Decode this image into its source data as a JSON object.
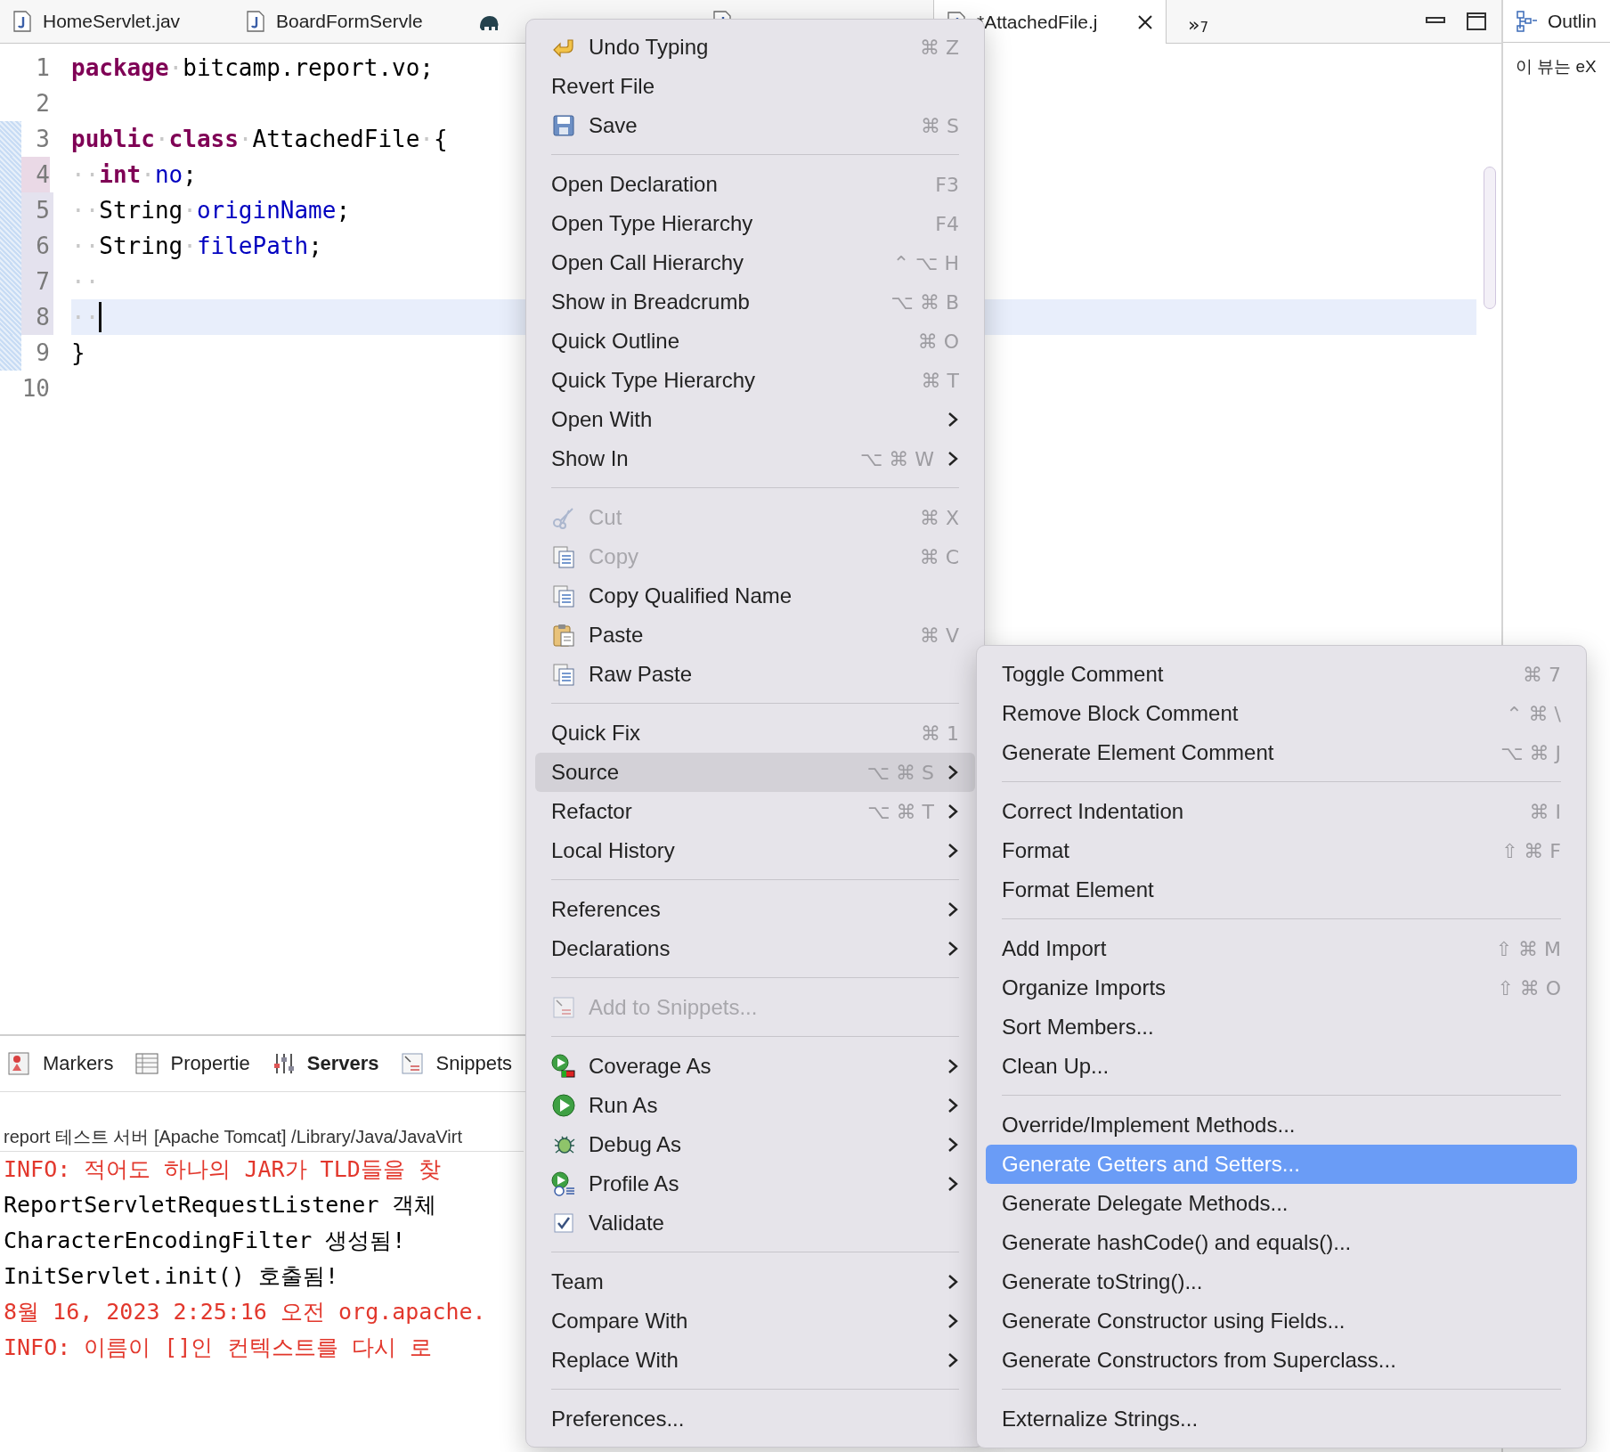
{
  "editor_tabs": [
    {
      "label": "HomeServlet.jav",
      "selected": false
    },
    {
      "label": "BoardFormServle",
      "selected": false
    },
    {
      "selected": false
    },
    {
      "selected": false
    },
    {
      "label": "*AttachedFile.j",
      "selected": true
    }
  ],
  "tab_overflow": {
    "symbol": "»",
    "count": "7"
  },
  "code_lines": [
    {
      "number": "1",
      "tokens": [
        {
          "text": "package",
          "kind": "keyword"
        },
        {
          "text": "·",
          "kind": "space"
        },
        {
          "text": "bitcamp.report.vo;",
          "kind": "plain"
        }
      ],
      "modified": false,
      "added": false,
      "range_indicator": false,
      "current": false
    },
    {
      "number": "2",
      "modified": false,
      "added": false,
      "range_indicator": false,
      "current": false
    },
    {
      "number": "3",
      "tokens": [
        {
          "text": "public",
          "kind": "keyword"
        },
        {
          "text": "·",
          "kind": "space"
        },
        {
          "text": "class",
          "kind": "keyword"
        },
        {
          "text": "·",
          "kind": "space"
        },
        {
          "text": "AttachedFile",
          "kind": "plain"
        },
        {
          "text": "·",
          "kind": "space"
        },
        {
          "text": "{",
          "kind": "plain"
        }
      ],
      "modified": false,
      "added": false,
      "range_indicator": true,
      "current": false
    },
    {
      "number": "4",
      "tokens": [
        {
          "text": "··",
          "kind": "space"
        },
        {
          "text": "int",
          "kind": "keyword"
        },
        {
          "text": "·",
          "kind": "space"
        },
        {
          "text": "no",
          "kind": "field"
        },
        {
          "text": ";",
          "kind": "plain"
        }
      ],
      "modified": true,
      "added": false,
      "range_indicator": true,
      "current": false
    },
    {
      "number": "5",
      "tokens": [
        {
          "text": "··",
          "kind": "space"
        },
        {
          "text": "String",
          "kind": "plain"
        },
        {
          "text": "·",
          "kind": "space"
        },
        {
          "text": "originName",
          "kind": "field"
        },
        {
          "text": ";",
          "kind": "plain"
        }
      ],
      "modified": false,
      "added": true,
      "range_indicator": true,
      "current": false
    },
    {
      "number": "6",
      "tokens": [
        {
          "text": "··",
          "kind": "space"
        },
        {
          "text": "String",
          "kind": "plain"
        },
        {
          "text": "·",
          "kind": "space"
        },
        {
          "text": "filePath",
          "kind": "field"
        },
        {
          "text": ";",
          "kind": "plain"
        }
      ],
      "modified": false,
      "added": true,
      "range_indicator": true,
      "current": false
    },
    {
      "number": "7",
      "tokens": [
        {
          "text": "··",
          "kind": "space"
        }
      ],
      "modified": false,
      "added": true,
      "range_indicator": true,
      "current": false
    },
    {
      "number": "8",
      "tokens": [
        {
          "text": "··",
          "kind": "space"
        }
      ],
      "modified": false,
      "added": true,
      "range_indicator": true,
      "current": true
    },
    {
      "number": "9",
      "tokens": [
        {
          "text": "}",
          "kind": "plain"
        }
      ],
      "modified": false,
      "added": false,
      "range_indicator": true,
      "current": false
    },
    {
      "number": "10",
      "modified": false,
      "added": false,
      "range_indicator": false,
      "current": false
    }
  ],
  "view_tabs": [
    {
      "label": "Markers",
      "selected": false
    },
    {
      "label": "Propertie",
      "selected": false
    },
    {
      "label": "Servers",
      "selected": true
    },
    {
      "label": "Snippets",
      "selected": false
    }
  ],
  "console": {
    "title": "report 테스트 서버 [Apache Tomcat] /Library/Java/JavaVirt",
    "lines": [
      {
        "text": "INFO: 적어도 하나의 JAR가 TLD들을 찾",
        "error": true
      },
      {
        "text": "ReportServletRequestListener 객체",
        "error": false
      },
      {
        "text": "CharacterEncodingFilter 생성됨!",
        "error": false
      },
      {
        "text": "InitServlet.init() 호출됨!",
        "error": false
      },
      {
        "text": "8월 16, 2023 2:25:16 오전 org.apache.",
        "error": true
      },
      {
        "text": "INFO: 이름이 []인 컨텍스트를 다시 로",
        "error": true
      }
    ]
  },
  "outline": {
    "tab": "Outlin",
    "message": "이 뷰는 eX"
  },
  "context_menu": {
    "groups": [
      {
        "items": [
          {
            "label": "Undo Typing",
            "shortcut": "⌘ Z",
            "submenu": false,
            "disabled": false,
            "selected": false
          },
          {
            "label": "Revert File",
            "submenu": false,
            "disabled": false,
            "selected": false
          },
          {
            "label": "Save",
            "shortcut": "⌘ S",
            "submenu": false,
            "disabled": false,
            "selected": false
          }
        ]
      },
      {
        "items": [
          {
            "label": "Open Declaration",
            "shortcut": "F3",
            "submenu": false,
            "disabled": false,
            "selected": false
          },
          {
            "label": "Open Type Hierarchy",
            "shortcut": "F4",
            "submenu": false,
            "disabled": false,
            "selected": false
          },
          {
            "label": "Open Call Hierarchy",
            "shortcut": "⌃ ⌥ H",
            "submenu": false,
            "disabled": false,
            "selected": false
          },
          {
            "label": "Show in Breadcrumb",
            "shortcut": "⌥ ⌘ B",
            "submenu": false,
            "disabled": false,
            "selected": false
          },
          {
            "label": "Quick Outline",
            "shortcut": "⌘ O",
            "submenu": false,
            "disabled": false,
            "selected": false
          },
          {
            "label": "Quick Type Hierarchy",
            "shortcut": "⌘ T",
            "submenu": false,
            "disabled": false,
            "selected": false
          },
          {
            "label": "Open With",
            "submenu": true,
            "disabled": false,
            "selected": false
          },
          {
            "label": "Show In",
            "shortcut": "⌥ ⌘ W",
            "submenu": true,
            "disabled": false,
            "selected": false
          }
        ]
      },
      {
        "items": [
          {
            "label": "Cut",
            "shortcut": "⌘ X",
            "submenu": false,
            "disabled": true,
            "selected": false
          },
          {
            "label": "Copy",
            "shortcut": "⌘ C",
            "submenu": false,
            "disabled": true,
            "selected": false
          },
          {
            "label": "Copy Qualified Name",
            "submenu": false,
            "disabled": false,
            "selected": false
          },
          {
            "label": "Paste",
            "shortcut": "⌘ V",
            "submenu": false,
            "disabled": false,
            "selected": false
          },
          {
            "label": "Raw Paste",
            "submenu": false,
            "disabled": false,
            "selected": false
          }
        ]
      },
      {
        "items": [
          {
            "label": "Quick Fix",
            "shortcut": "⌘ 1",
            "submenu": false,
            "disabled": false,
            "selected": false
          },
          {
            "label": "Source",
            "shortcut": "⌥ ⌘ S",
            "submenu": true,
            "disabled": false,
            "selected": true
          },
          {
            "label": "Refactor",
            "shortcut": "⌥ ⌘ T",
            "submenu": true,
            "disabled": false,
            "selected": false
          },
          {
            "label": "Local History",
            "submenu": true,
            "disabled": false,
            "selected": false
          }
        ]
      },
      {
        "items": [
          {
            "label": "References",
            "submenu": true,
            "disabled": false,
            "selected": false
          },
          {
            "label": "Declarations",
            "submenu": true,
            "disabled": false,
            "selected": false
          }
        ]
      },
      {
        "items": [
          {
            "label": "Add to Snippets...",
            "submenu": false,
            "disabled": true,
            "selected": false
          }
        ]
      },
      {
        "items": [
          {
            "label": "Coverage As",
            "submenu": true,
            "disabled": false,
            "selected": false
          },
          {
            "label": "Run As",
            "submenu": true,
            "disabled": false,
            "selected": false
          },
          {
            "label": "Debug As",
            "submenu": true,
            "disabled": false,
            "selected": false
          },
          {
            "label": "Profile As",
            "submenu": true,
            "disabled": false,
            "selected": false
          },
          {
            "label": "Validate",
            "submenu": false,
            "disabled": false,
            "selected": false
          }
        ]
      },
      {
        "items": [
          {
            "label": "Team",
            "submenu": true,
            "disabled": false,
            "selected": false
          },
          {
            "label": "Compare With",
            "submenu": true,
            "disabled": false,
            "selected": false
          },
          {
            "label": "Replace With",
            "submenu": true,
            "disabled": false,
            "selected": false
          }
        ]
      },
      {
        "items": [
          {
            "label": "Preferences...",
            "submenu": false,
            "disabled": false,
            "selected": false
          }
        ]
      }
    ]
  },
  "source_submenu": {
    "groups": [
      {
        "items": [
          {
            "label": "Toggle Comment",
            "shortcut": "⌘ 7",
            "selected": false
          },
          {
            "label": "Remove Block Comment",
            "shortcut": "⌃ ⌘ \\",
            "selected": false
          },
          {
            "label": "Generate Element Comment",
            "shortcut": "⌥ ⌘ J",
            "selected": false
          }
        ]
      },
      {
        "items": [
          {
            "label": "Correct Indentation",
            "shortcut": "⌘ I",
            "selected": false
          },
          {
            "label": "Format",
            "shortcut": "⇧ ⌘ F",
            "selected": false
          },
          {
            "label": "Format Element",
            "selected": false
          }
        ]
      },
      {
        "items": [
          {
            "label": "Add Import",
            "shortcut": "⇧ ⌘ M",
            "selected": false
          },
          {
            "label": "Organize Imports",
            "shortcut": "⇧ ⌘ O",
            "selected": false
          },
          {
            "label": "Sort Members...",
            "selected": false
          },
          {
            "label": "Clean Up...",
            "selected": false
          }
        ]
      },
      {
        "items": [
          {
            "label": "Override/Implement Methods...",
            "selected": false
          },
          {
            "label": "Generate Getters and Setters...",
            "selected": true
          },
          {
            "label": "Generate Delegate Methods...",
            "selected": false
          },
          {
            "label": "Generate hashCode() and equals()...",
            "selected": false
          },
          {
            "label": "Generate toString()...",
            "selected": false
          },
          {
            "label": "Generate Constructor using Fields...",
            "selected": false
          },
          {
            "label": "Generate Constructors from Superclass...",
            "selected": false
          }
        ]
      },
      {
        "items": [
          {
            "label": "Externalize Strings...",
            "selected": false
          }
        ]
      }
    ]
  }
}
